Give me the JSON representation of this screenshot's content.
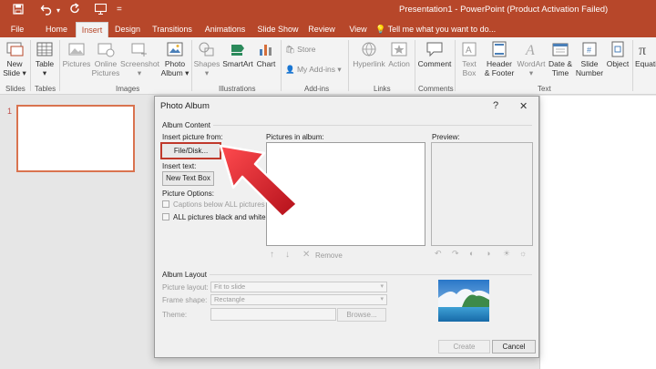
{
  "title_bar": {
    "title": "Presentation1 - PowerPoint (Product Activation Failed)",
    "save_icon": "save-icon",
    "undo_icon": "undo-icon",
    "redo_icon": "redo-icon",
    "present_icon": "present-icon",
    "brand_color": "#b7472a"
  },
  "tabs": [
    "File",
    "Home",
    "Insert",
    "Design",
    "Transitions",
    "Animations",
    "Slide Show",
    "Review",
    "View"
  ],
  "active_tab": "Insert",
  "tell_me": "Tell me what you want to do...",
  "ribbon": {
    "buttons": [
      {
        "l1": "New",
        "l2": "Slide ▾",
        "icon": "new-slide-icon"
      },
      {
        "l1": "Table",
        "l2": "▾",
        "icon": "table-icon"
      },
      {
        "l1": "Pictures",
        "l2": "",
        "icon": "pictures-icon"
      },
      {
        "l1": "Online",
        "l2": "Pictures",
        "icon": "online-pictures-icon"
      },
      {
        "l1": "Screenshot",
        "l2": "▾",
        "icon": "screenshot-icon"
      },
      {
        "l1": "Photo",
        "l2": "Album ▾",
        "icon": "photo-album-icon"
      },
      {
        "l1": "Shapes",
        "l2": "▾",
        "icon": "shapes-icon"
      },
      {
        "l1": "SmartArt",
        "l2": "",
        "icon": "smartart-icon"
      },
      {
        "l1": "Chart",
        "l2": "",
        "icon": "chart-icon"
      },
      {
        "l1": "Hyperlink",
        "l2": "",
        "icon": "hyperlink-icon"
      },
      {
        "l1": "Action",
        "l2": "",
        "icon": "action-icon"
      },
      {
        "l1": "Comment",
        "l2": "",
        "icon": "comment-icon"
      },
      {
        "l1": "Text",
        "l2": "Box",
        "icon": "text-box-icon"
      },
      {
        "l1": "Header",
        "l2": "& Footer",
        "icon": "header-footer-icon"
      },
      {
        "l1": "WordArt",
        "l2": "▾",
        "icon": "wordart-icon"
      },
      {
        "l1": "Date &",
        "l2": "Time",
        "icon": "date-time-icon"
      },
      {
        "l1": "Slide",
        "l2": "Number",
        "icon": "slide-number-icon"
      },
      {
        "l1": "Object",
        "l2": "",
        "icon": "object-icon"
      },
      {
        "l1": "Equatio",
        "l2": "",
        "icon": "equation-icon"
      }
    ],
    "store": "Store",
    "my_addins": "My Add-ins",
    "groups": [
      "Slides",
      "Tables",
      "Images",
      "Illustrations",
      "Add-ins",
      "Links",
      "Comments",
      "Text"
    ]
  },
  "slide_panel": {
    "number": "1"
  },
  "dialog": {
    "title": "Photo Album",
    "help": "?",
    "close": "✕",
    "album_content": "Album Content",
    "insert_picture_from": "Insert picture from:",
    "file_disk": "File/Disk...",
    "insert_text": "Insert text:",
    "new_text_box": "New Text Box",
    "picture_options": "Picture Options:",
    "captions": "Captions below ALL pictures",
    "black_white": "ALL pictures black and white",
    "pictures_in_album": "Pictures in album:",
    "preview": "Preview:",
    "remove": "Remove",
    "album_layout": "Album Layout",
    "picture_layout_label": "Picture layout:",
    "picture_layout_value": "Fit to slide",
    "frame_shape_label": "Frame shape:",
    "frame_shape_value": "Rectangle",
    "theme_label": "Theme:",
    "browse": "Browse...",
    "create": "Create",
    "cancel": "Cancel",
    "highlight_color": "#c0392b",
    "arrow_color": "#e0252b"
  }
}
